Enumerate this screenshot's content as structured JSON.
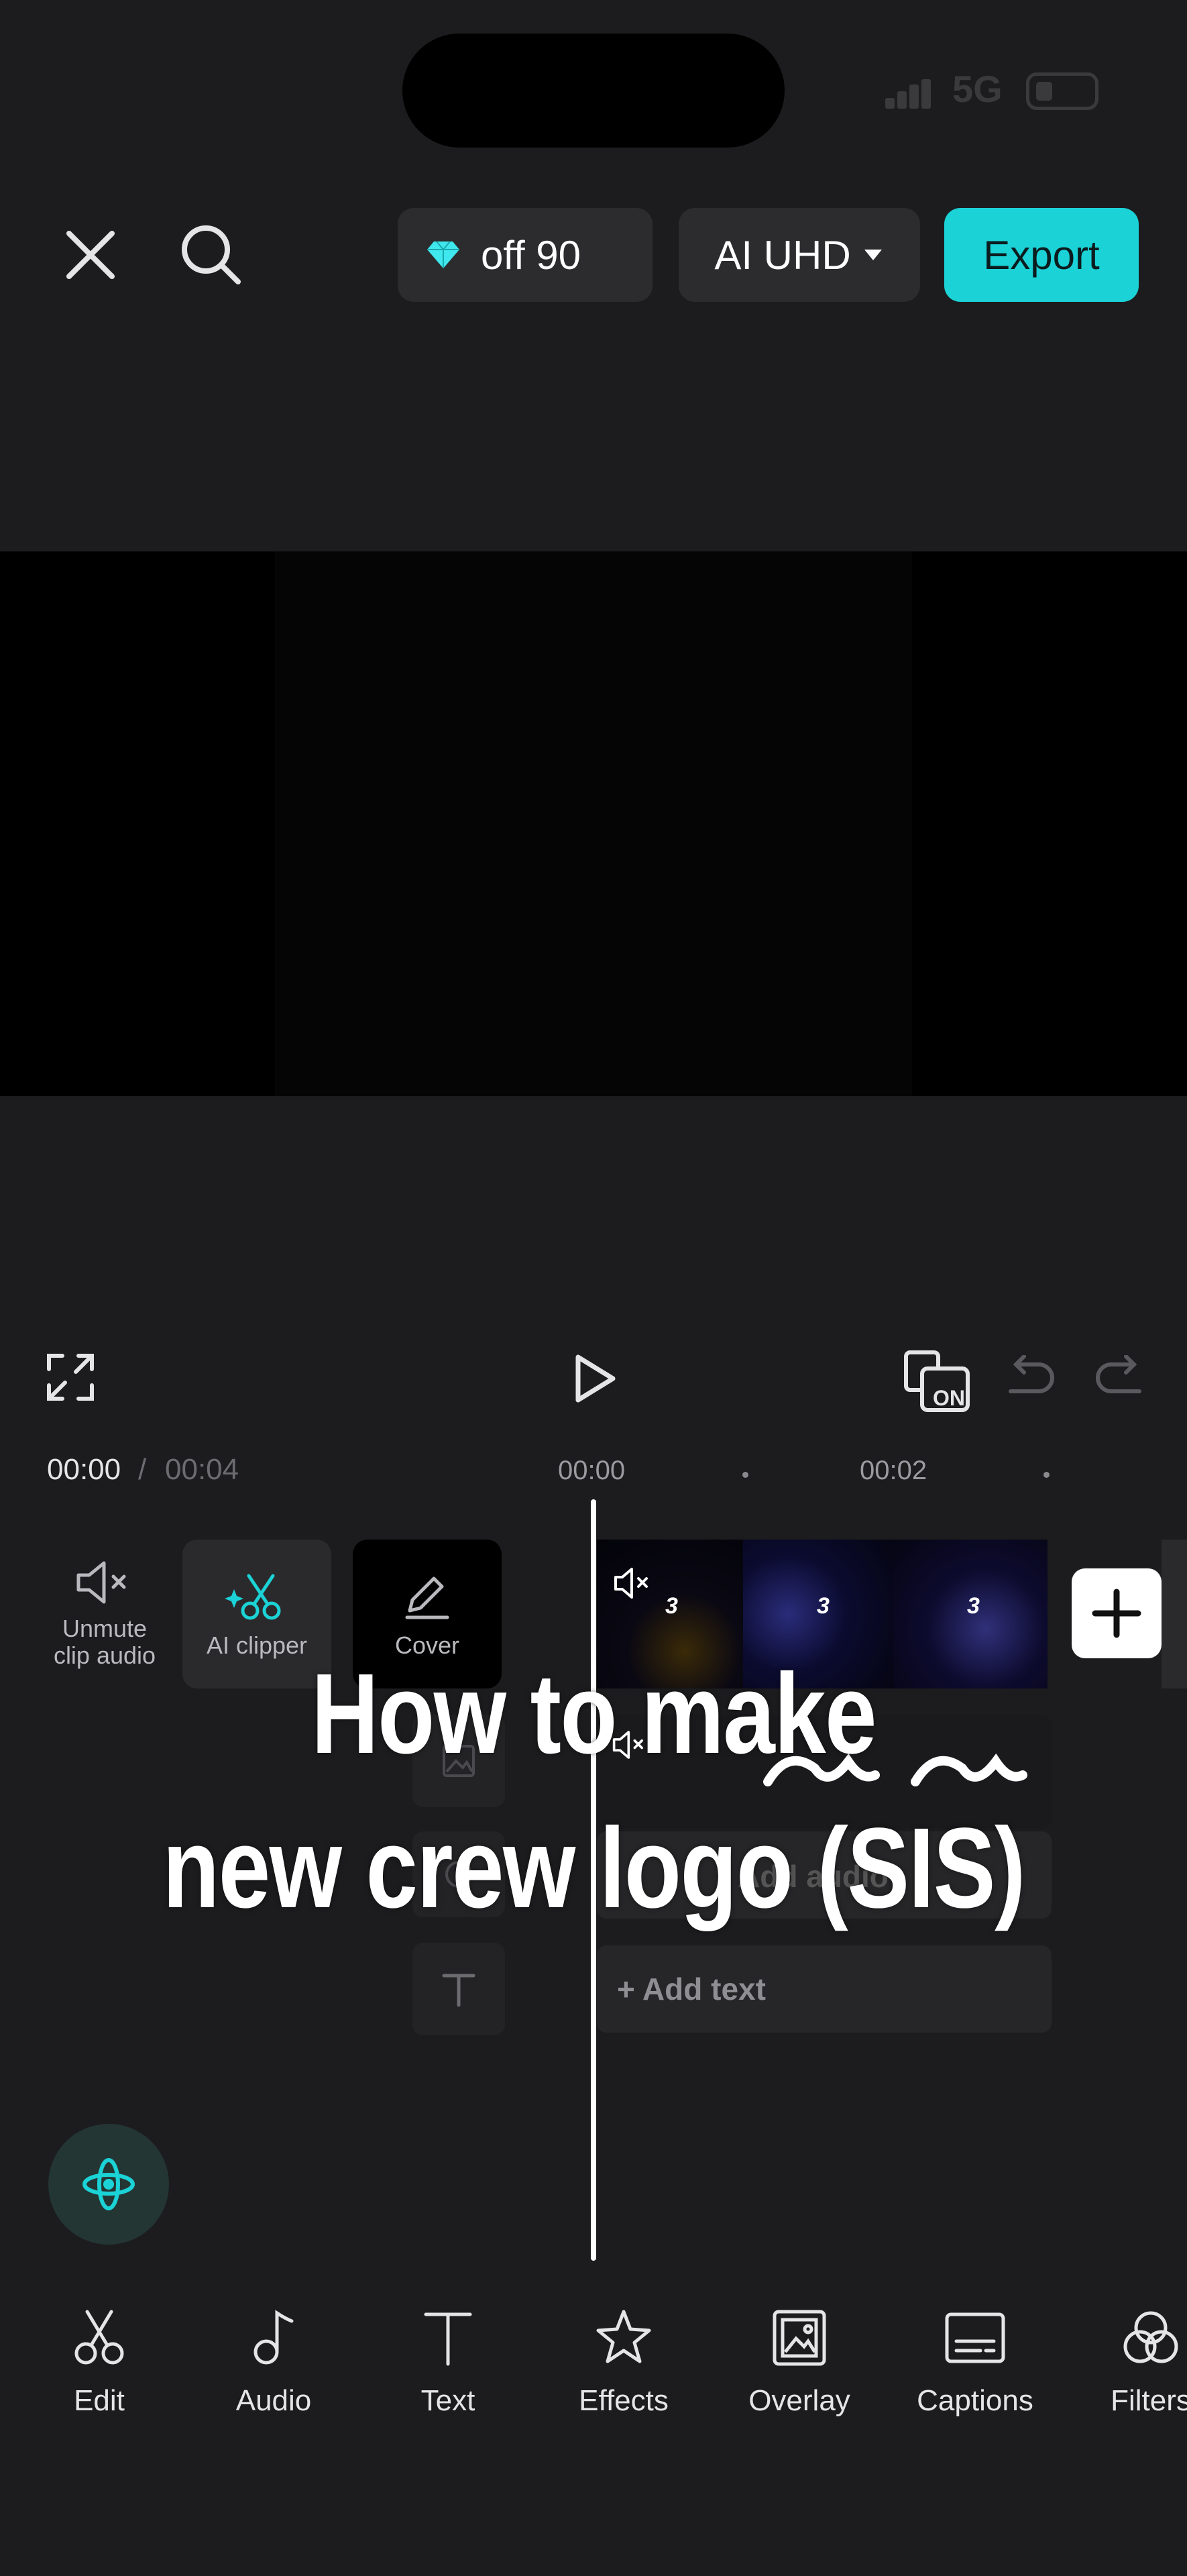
{
  "status_bar": {
    "network": "5G"
  },
  "toolbar": {
    "close_icon": "close-icon",
    "search_icon": "search-icon",
    "promo_text": "off  90",
    "quality_label": "AI UHD",
    "export_label": "Export",
    "accent_color": "#1bd2d6"
  },
  "playback": {
    "fullscreen_icon": "fullscreen-icon",
    "play_icon": "play-icon",
    "keyframe_badge": "ON",
    "undo_icon": "undo-icon",
    "redo_icon": "redo-icon"
  },
  "timeline": {
    "current_time": "00:00",
    "separator": "/",
    "total_time": "00:04",
    "ticks": [
      "00:00",
      "00:02"
    ]
  },
  "tools": {
    "unmute": "Unmute clip audio",
    "ai_clipper": "AI clipper",
    "cover": "Cover"
  },
  "tracks": {
    "clip_badge": "3",
    "add_audio_label": "Add audio",
    "add_text_label": "+ Add text"
  },
  "overlay": {
    "line1": "How to make",
    "line2": "new crew logo (SIS)"
  },
  "bottom_nav": [
    {
      "label": "Edit",
      "icon": "scissors-icon"
    },
    {
      "label": "Audio",
      "icon": "music-note-icon"
    },
    {
      "label": "Text",
      "icon": "text-icon"
    },
    {
      "label": "Effects",
      "icon": "effects-star-icon"
    },
    {
      "label": "Overlay",
      "icon": "overlay-icon"
    },
    {
      "label": "Captions",
      "icon": "captions-icon"
    },
    {
      "label": "Filters",
      "icon": "filters-icon"
    }
  ]
}
